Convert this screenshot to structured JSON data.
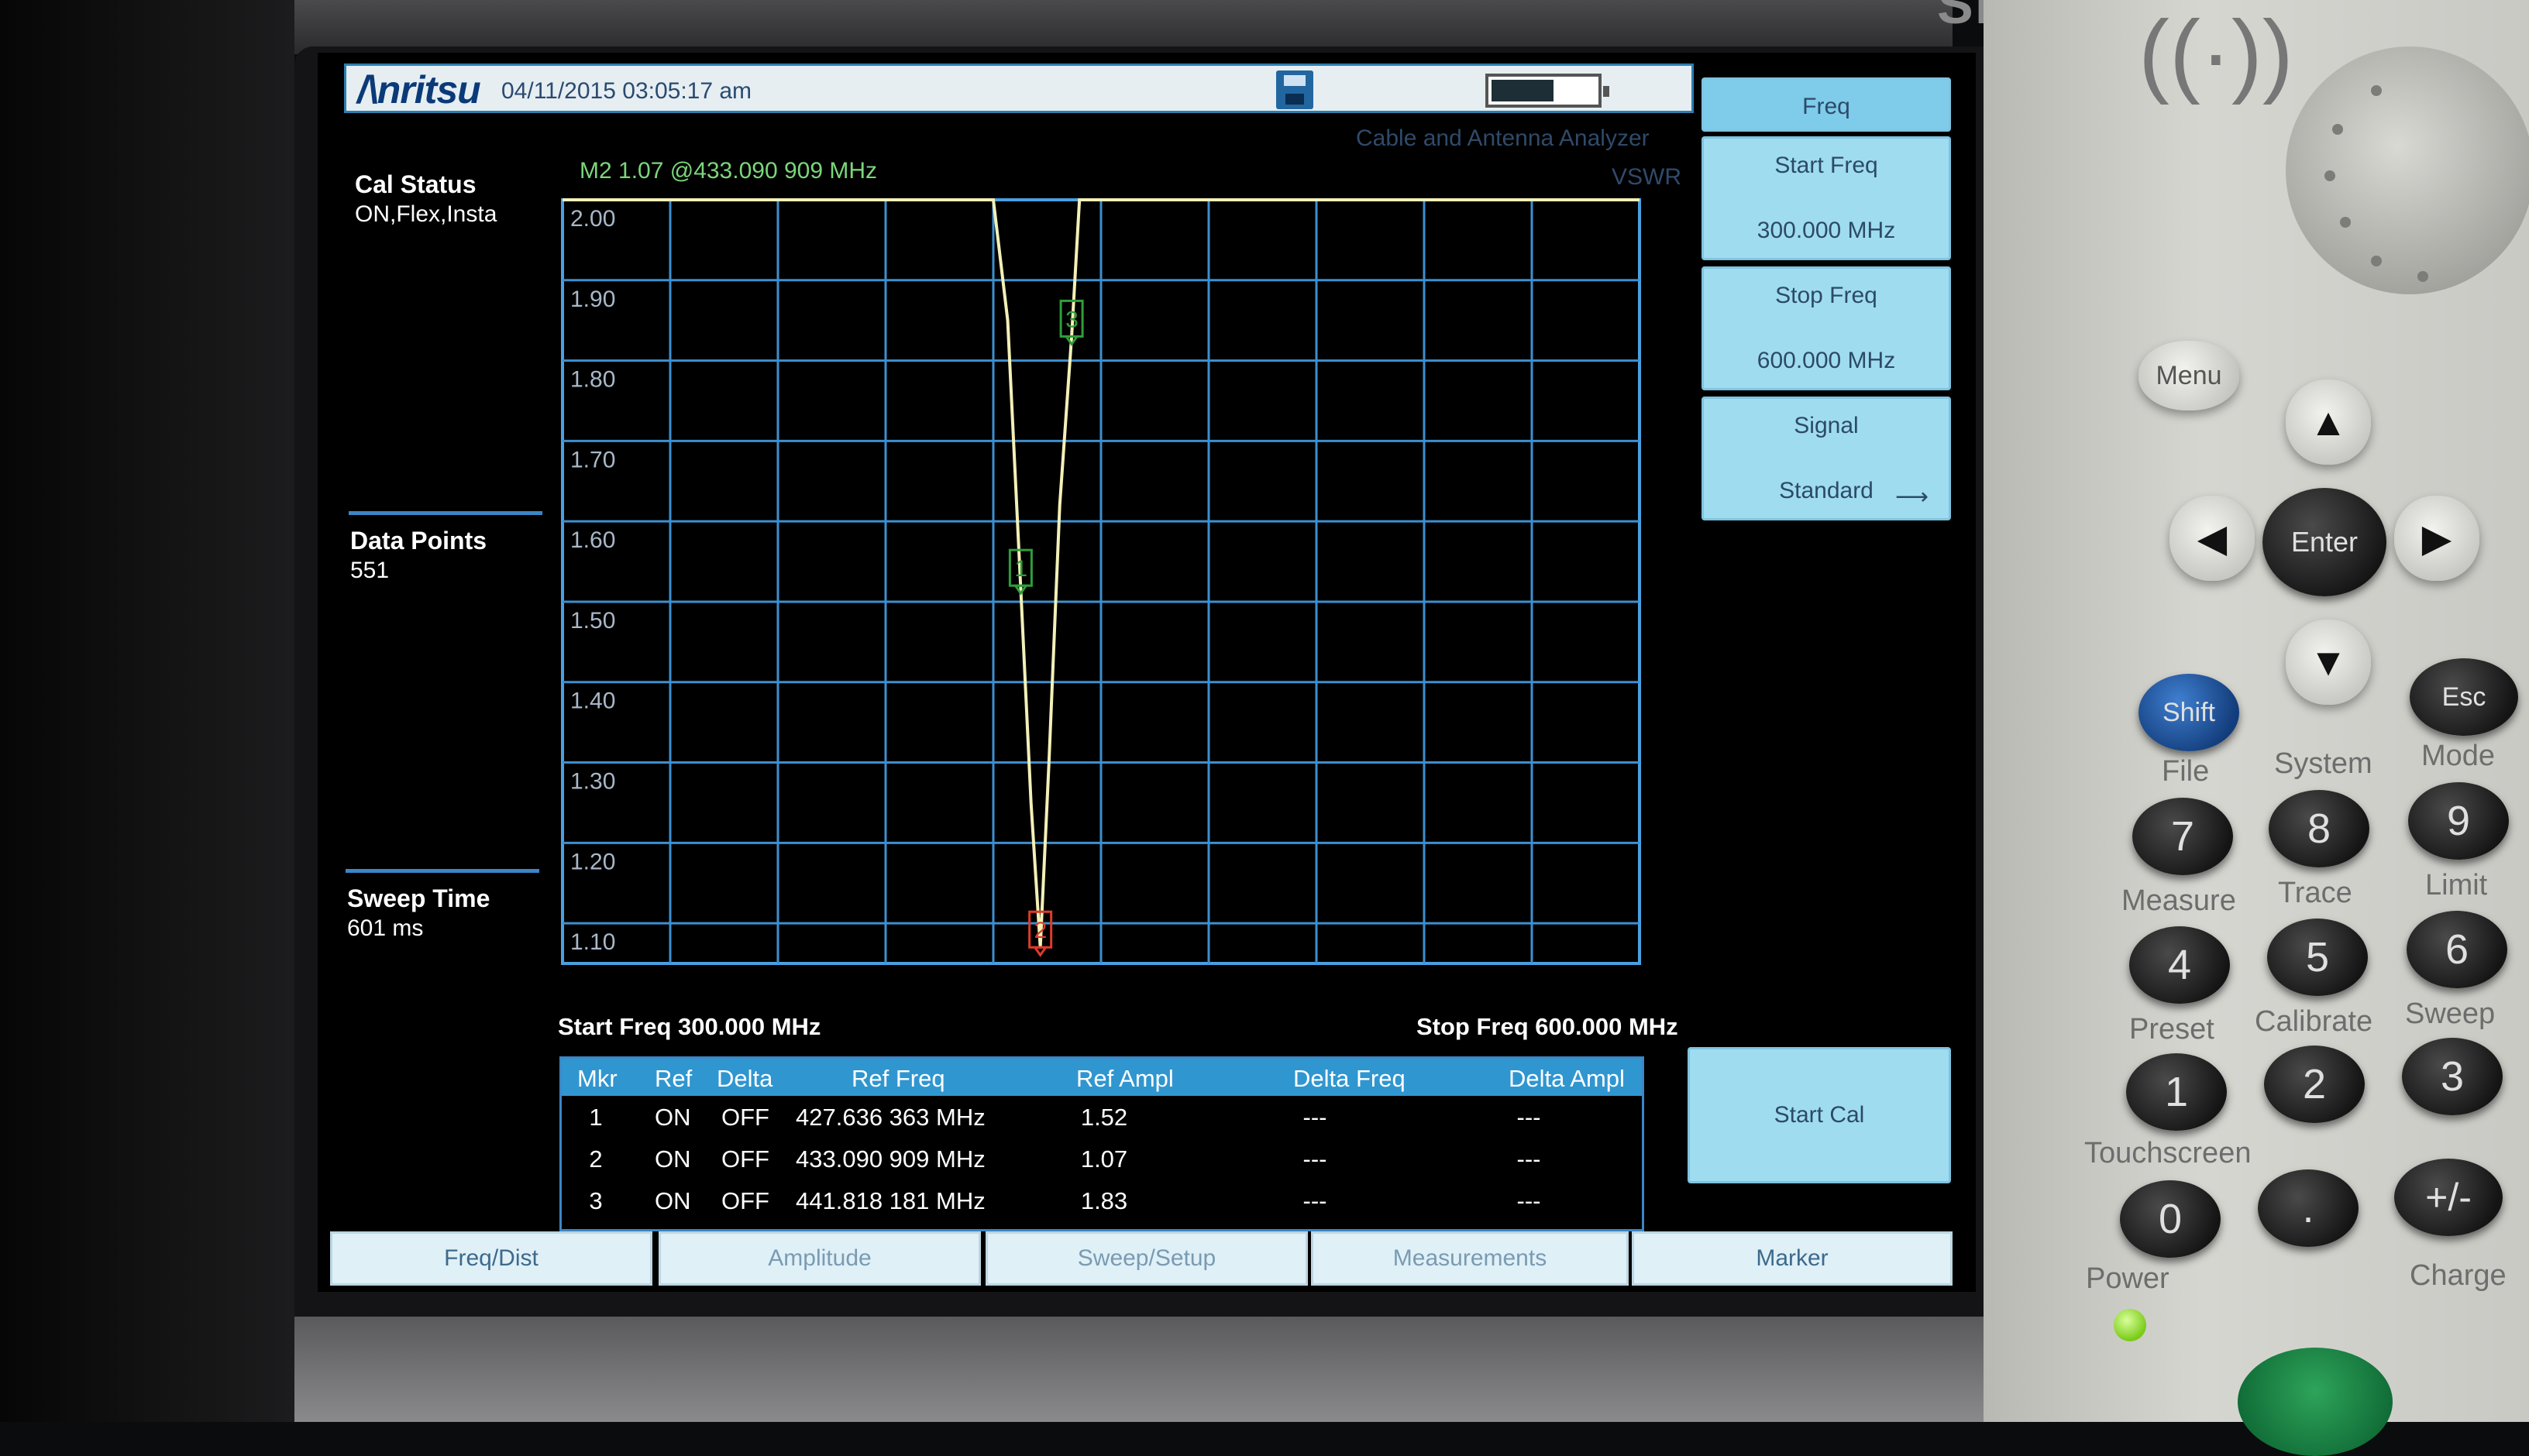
{
  "device": {
    "brand": "Anritsu",
    "model_partial": "SiteMaster"
  },
  "header": {
    "logo": "/\\nritsu",
    "datetime": "04/11/2015 03:05:17 am",
    "mode": "Cable and Antenna Analyzer",
    "measurement": "VSWR"
  },
  "side": {
    "cal_status_title": "Cal Status",
    "cal_status_value": "ON,Flex,Insta",
    "data_points_title": "Data Points",
    "data_points_value": "551",
    "sweep_time_title": "Sweep Time",
    "sweep_time_value": "601 ms"
  },
  "marker_readout": "M2 1.07 @433.090 909 MHz",
  "chart_data": {
    "type": "line",
    "title": "",
    "xlabel": "",
    "ylabel": "",
    "xlim": [
      300.0,
      600.0
    ],
    "ylim": [
      1.05,
      2.0
    ],
    "ytick_labels": [
      "2.00",
      "1.90",
      "1.80",
      "1.70",
      "1.60",
      "1.50",
      "1.40",
      "1.30",
      "1.20",
      "1.10"
    ],
    "grid": true,
    "x_divisions": 10,
    "series": [
      {
        "color": "#f2f0b8",
        "x": [
          300.0,
          420.0,
          424.0,
          427.6,
          430.5,
          433.09,
          435.5,
          438.5,
          441.82,
          444.0,
          600.0
        ],
        "y": [
          2.0,
          2.0,
          1.85,
          1.52,
          1.25,
          1.07,
          1.3,
          1.62,
          1.83,
          2.0,
          2.0
        ]
      }
    ],
    "markers": [
      {
        "label": "1",
        "x": 427.636,
        "y": 1.52,
        "color": "#2e9e3a"
      },
      {
        "label": "2",
        "x": 433.091,
        "y": 1.07,
        "color": "#e03a2a"
      },
      {
        "label": "3",
        "x": 441.818,
        "y": 1.83,
        "color": "#2e9e3a"
      }
    ]
  },
  "freq_axis": {
    "start": "Start Freq 300.000 MHz",
    "stop": "Stop Freq 600.000 MHz"
  },
  "marker_table": {
    "headers": [
      "Mkr",
      "Ref",
      "Delta",
      "Ref Freq",
      "Ref Ampl",
      "Delta Freq",
      "Delta Ampl"
    ],
    "rows": [
      [
        "1",
        "ON",
        "OFF",
        "427.636 363 MHz",
        "1.52",
        "---",
        "---"
      ],
      [
        "2",
        "ON",
        "OFF",
        "433.090 909 MHz",
        "1.07",
        "---",
        "---"
      ],
      [
        "3",
        "ON",
        "OFF",
        "441.818 181 MHz",
        "1.83",
        "---",
        "---"
      ]
    ]
  },
  "softkeys": {
    "menu_title": "Freq",
    "start_freq_label": "Start Freq",
    "start_freq_value": "300.000 MHz",
    "stop_freq_label": "Stop Freq",
    "stop_freq_value": "600.000 MHz",
    "signal_label": "Signal",
    "signal_value": "Standard",
    "start_cal": "Start Cal"
  },
  "bottom_tabs": [
    "Freq/Dist",
    "Amplitude",
    "Sweep/Setup",
    "Measurements",
    "Marker"
  ],
  "keypad": {
    "menu": "Menu",
    "enter": "Enter",
    "esc": "Esc",
    "shift": "Shift",
    "labels": [
      "File",
      "System",
      "Mode",
      "Measure",
      "Trace",
      "Limit",
      "Preset",
      "Calibrate",
      "Sweep",
      "Touchscreen",
      "Power",
      "Charge"
    ],
    "digits": [
      "7",
      "8",
      "9",
      "4",
      "5",
      "6",
      "1",
      "2",
      "3",
      "0",
      ".",
      "+/-"
    ]
  }
}
